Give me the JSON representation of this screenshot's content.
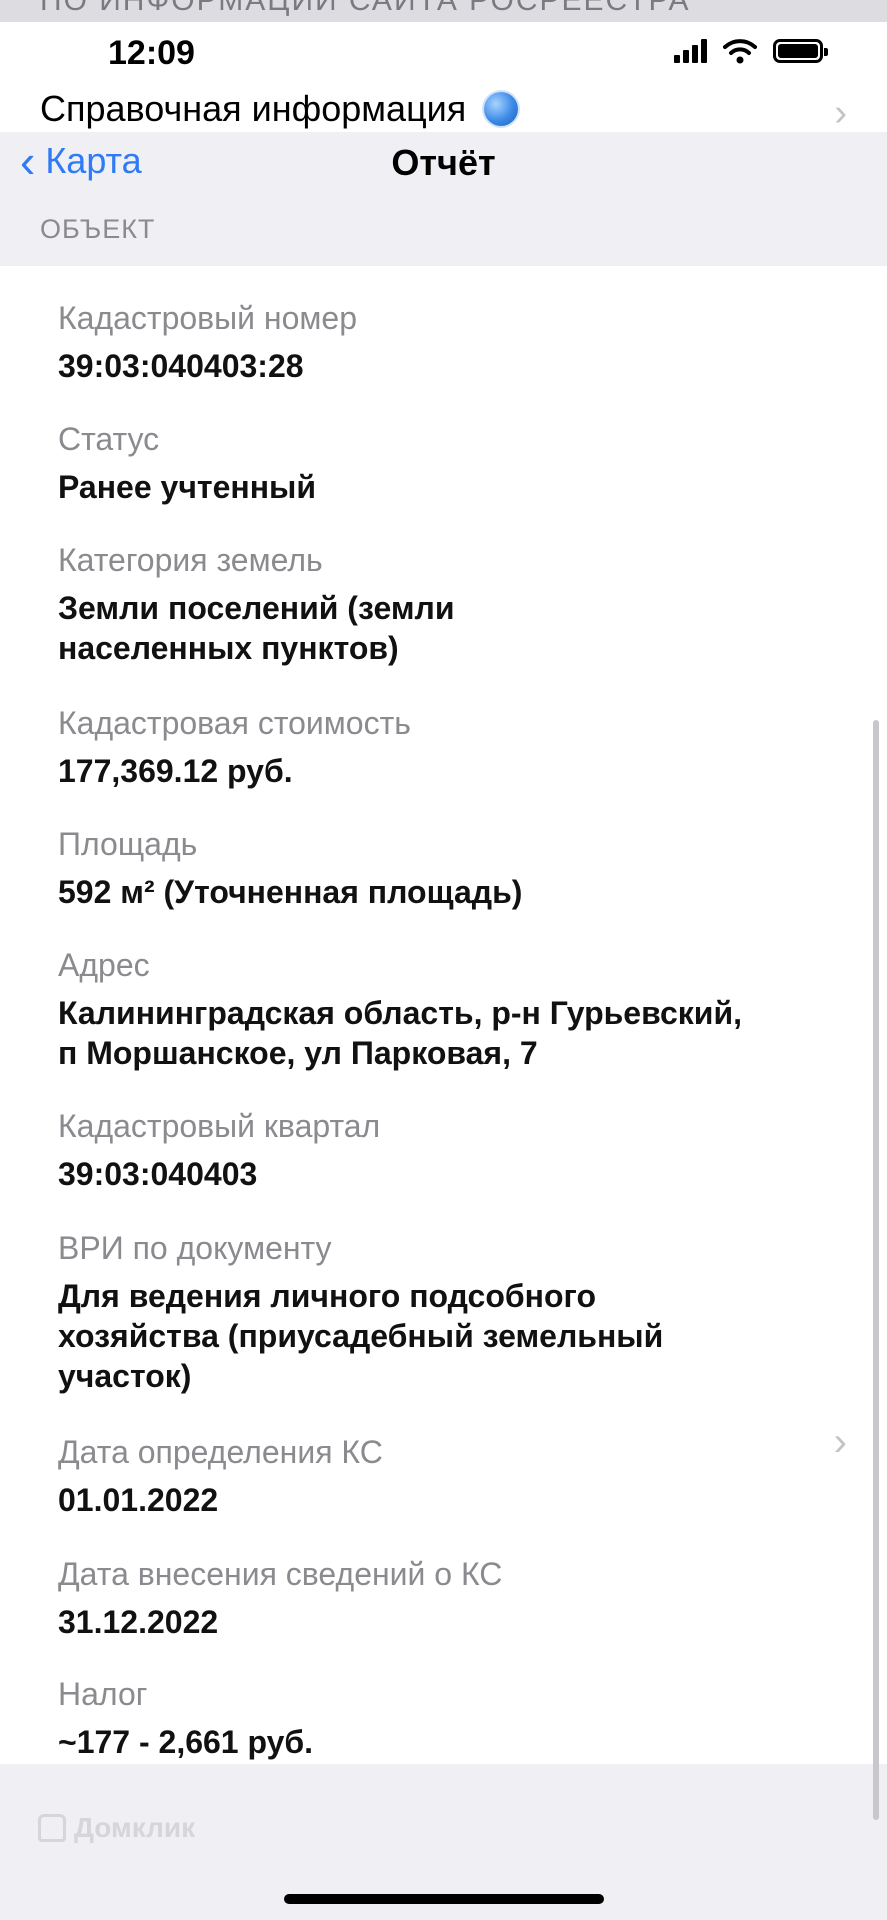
{
  "top_strip": {
    "text": "ПО ИНФОРМАЦИИ САЙТА РОСРЕЕСТРА"
  },
  "status_bar": {
    "time": "12:09"
  },
  "header": {
    "reference_label": "Справочная информация",
    "back_label": "Карта",
    "title": "Отчёт"
  },
  "section": {
    "title": "ОБЪЕКТ"
  },
  "fields": [
    {
      "label": "Кадастровый номер",
      "value": "39:03:040403:28"
    },
    {
      "label": "Статус",
      "value": "Ранее учтенный"
    },
    {
      "label": "Категория земель",
      "value": "Земли поселений (земли\nнаселенных пунктов)"
    },
    {
      "label": "Кадастровая стоимость",
      "value": "177,369.12 руб."
    },
    {
      "label": "Площадь",
      "value": "592 м² (Уточненная площадь)"
    },
    {
      "label": "Адрес",
      "value": "Калининградская область, р-н Гурьевский,\nп Моршанское, ул Парковая, 7"
    },
    {
      "label": "Кадастровый квартал",
      "value": "39:03:040403"
    },
    {
      "label": "ВРИ по документу",
      "value": "Для ведения личного подсобного\nхозяйства (приусадебный земельный\nучасток)"
    },
    {
      "label": "Дата определения КС",
      "value": "01.01.2022"
    },
    {
      "label": "Дата внесения сведений о КС",
      "value": "31.12.2022"
    },
    {
      "label": "Налог",
      "value": "~177 - 2,661 руб."
    }
  ],
  "watermark": {
    "text": "Домклик"
  }
}
